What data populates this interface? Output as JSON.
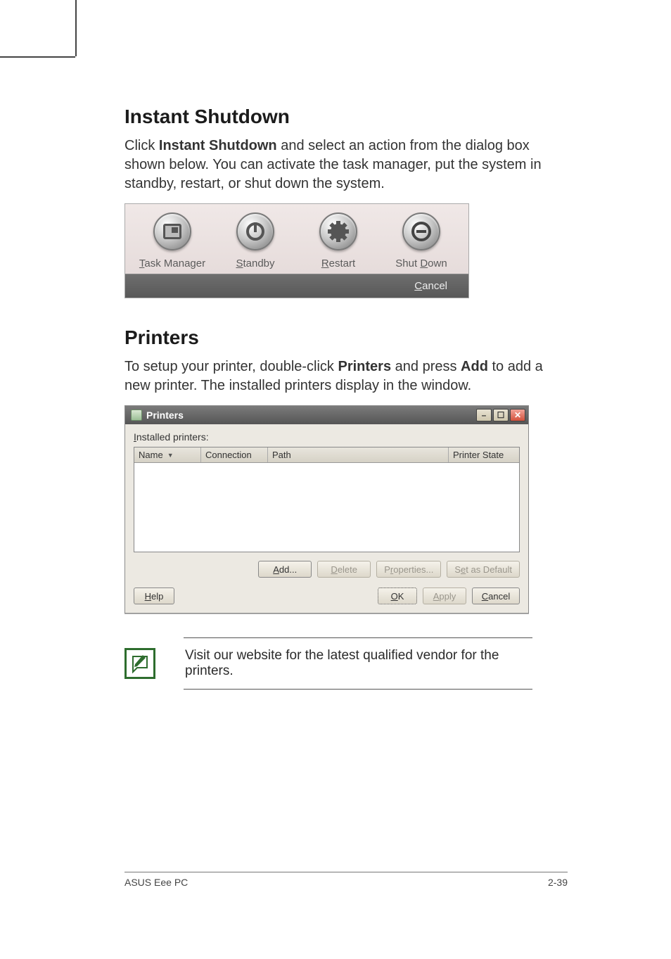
{
  "section1": {
    "title": "Instant Shutdown",
    "body_pre": "Click ",
    "body_bold": "Instant Shutdown",
    "body_post": " and select an action from the dialog box shown below. You can activate the task manager, put the system in standby, restart, or shut down the system."
  },
  "shutdown_dialog": {
    "items": [
      {
        "label_html": "<u>T</u>ask Manager",
        "name": "task-manager"
      },
      {
        "label_html": "<u>S</u>tandby",
        "name": "standby"
      },
      {
        "label_html": "<u>R</u>estart",
        "name": "restart"
      },
      {
        "label_html": "Shut <u>D</u>own",
        "name": "shut-down"
      }
    ],
    "cancel_html": "<u>C</u>ancel"
  },
  "section2": {
    "title": "Printers",
    "body_pre": "To setup your printer, double-click ",
    "body_bold1": "Printers",
    "body_mid": " and press ",
    "body_bold2": "Add",
    "body_post": " to add a new printer. The installed printers display in the window."
  },
  "printers_window": {
    "title": "Printers",
    "installed_label_html": "<u>I</u>nstalled printers:",
    "columns": {
      "name": "Name",
      "connection": "Connection",
      "path": "Path",
      "state": "Printer State"
    },
    "rows": [],
    "buttons_row1": {
      "add_html": "<u>A</u>dd...",
      "delete_html": "<u>D</u>elete",
      "properties_html": "P<u>r</u>operties...",
      "set_default_html": "S<u>e</u>t as Default"
    },
    "buttons_row2": {
      "help_html": "<u>H</u>elp",
      "ok_html": "<u>O</u>K",
      "apply_html": "<u>A</u>pply",
      "cancel_html": "<u>C</u>ancel"
    }
  },
  "note": {
    "text": "Visit our website for the latest qualified vendor for the printers."
  },
  "footer": {
    "left": "ASUS Eee PC",
    "right": "2-39"
  }
}
